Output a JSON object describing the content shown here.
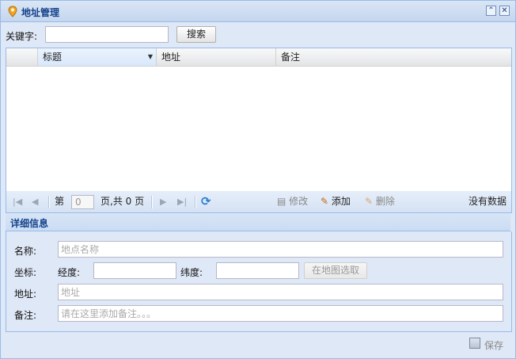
{
  "window": {
    "title": "地址管理",
    "icons": {
      "title": "map-pin-icon",
      "collapse": "double-chevron-up-icon",
      "close": "close-icon"
    }
  },
  "search": {
    "label": "关键字:",
    "value": "",
    "button": "搜索"
  },
  "grid": {
    "columns": [
      "标题",
      "地址",
      "备注"
    ],
    "rows": []
  },
  "pager": {
    "page_prefix": "第",
    "page_value": "0",
    "page_suffix": "页,共 0 页",
    "edit": "修改",
    "add": "添加",
    "delete": "删除",
    "status": "没有数据"
  },
  "details": {
    "title": "详细信息",
    "name_label": "名称:",
    "name_placeholder": "地点名称",
    "coord_label": "坐标:",
    "lng_label": "经度:",
    "lat_label": "纬度:",
    "map_button": "在地图选取",
    "address_label": "地址:",
    "address_placeholder": "地址",
    "note_label": "备注:",
    "note_placeholder": "请在这里添加备注。。。"
  },
  "footer": {
    "save": "保存"
  },
  "colors": {
    "window_bg": "#dfe8f6",
    "border": "#99bbe8",
    "title_text": "#15428b"
  }
}
